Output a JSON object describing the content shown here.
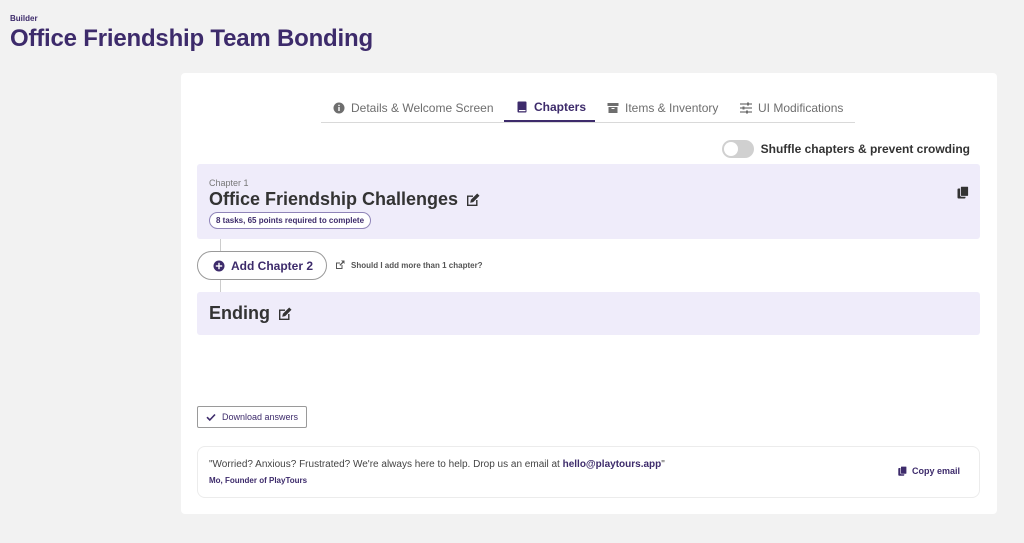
{
  "header": {
    "eyebrow": "Builder",
    "title": "Office Friendship Team Bonding"
  },
  "tabs": [
    {
      "label": "Details & Welcome Screen",
      "icon": "info-icon",
      "active": false
    },
    {
      "label": "Chapters",
      "icon": "book-icon",
      "active": true
    },
    {
      "label": "Items & Inventory",
      "icon": "box-icon",
      "active": false
    },
    {
      "label": "UI Modifications",
      "icon": "sliders-icon",
      "active": false
    }
  ],
  "shuffle": {
    "label": "Shuffle chapters & prevent crowding",
    "enabled": false
  },
  "chapters": [
    {
      "label": "Chapter 1",
      "title": "Office Friendship Challenges",
      "badge": "8 tasks, 65 points required to complete"
    }
  ],
  "add_chapter": {
    "label": "Add Chapter 2",
    "help": "Should I add more than 1 chapter?"
  },
  "ending": {
    "title": "Ending"
  },
  "download": {
    "label": "Download answers"
  },
  "support": {
    "quote_prefix": "\"Worried? Anxious? Frustrated? We're always here to help. Drop us an email at ",
    "email": "hello@playtours.app",
    "quote_suffix": "\"",
    "signature": "Mo, Founder of PlayTours",
    "copy_label": "Copy email"
  },
  "colors": {
    "brand": "#3d2b6b",
    "card_bg": "#efecfa",
    "page_bg": "#f2f2f2"
  }
}
